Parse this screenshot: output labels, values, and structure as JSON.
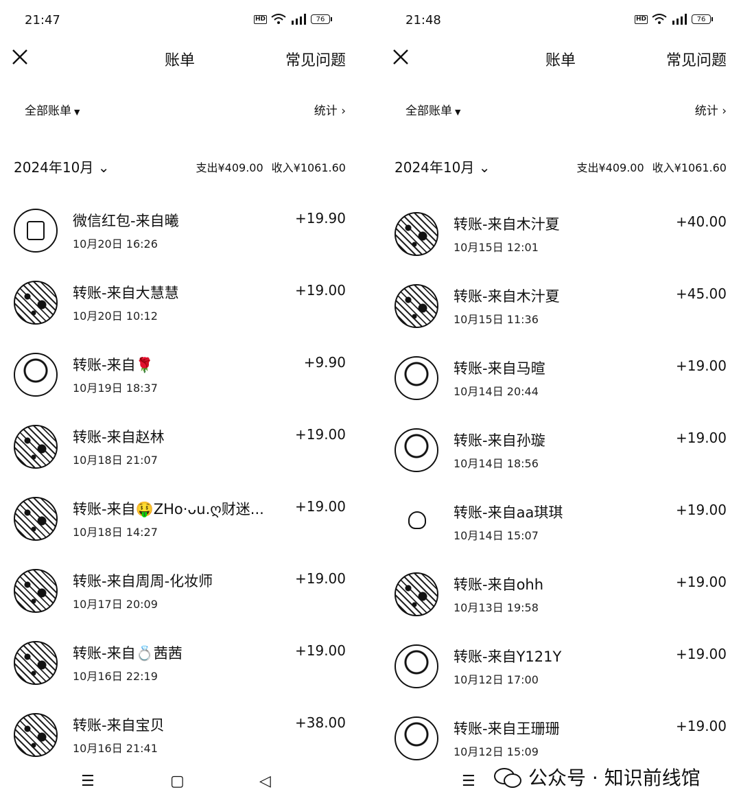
{
  "left": {
    "status_time": "21:47",
    "hd": "HD",
    "battery": "76",
    "title": "账单",
    "faq": "常见问题",
    "filter": "全部账单",
    "stats": "统计",
    "month": "2024年10月",
    "expense": "支出¥409.00",
    "income": "收入¥1061.60",
    "rows": [
      {
        "title": "微信红包-来自曦",
        "time": "10月20日 16:26",
        "amount": "+19.90",
        "avatar": "redpacket"
      },
      {
        "title": "转账-来自大慧慧",
        "time": "10月20日 10:12",
        "amount": "+19.00",
        "avatar": "pattern"
      },
      {
        "title": "转账-来自🌹",
        "time": "10月19日 18:37",
        "amount": "+9.90",
        "avatar": "sketch"
      },
      {
        "title": "转账-来自赵林",
        "time": "10月18日 21:07",
        "amount": "+19.00",
        "avatar": "pattern"
      },
      {
        "title": "转账-来自🤑ZHo·ᴗu.ღ财迷...",
        "time": "10月18日 14:27",
        "amount": "+19.00",
        "avatar": "pattern"
      },
      {
        "title": "转账-来自周周-化妆师",
        "time": "10月17日 20:09",
        "amount": "+19.00",
        "avatar": "pattern"
      },
      {
        "title": "转账-来自💍茜茜",
        "time": "10月16日 22:19",
        "amount": "+19.00",
        "avatar": "pattern"
      },
      {
        "title": "转账-来自宝贝",
        "time": "10月16日 21:41",
        "amount": "+38.00",
        "avatar": "pattern"
      }
    ]
  },
  "right": {
    "status_time": "21:48",
    "hd": "HD",
    "battery": "76",
    "title": "账单",
    "faq": "常见问题",
    "filter": "全部账单",
    "stats": "统计",
    "month": "2024年10月",
    "expense": "支出¥409.00",
    "income": "收入¥1061.60",
    "rows": [
      {
        "title": "转账-来自木汁夏",
        "time": "10月15日 12:01",
        "amount": "+40.00",
        "avatar": "pattern"
      },
      {
        "title": "转账-来自木汁夏",
        "time": "10月15日 11:36",
        "amount": "+45.00",
        "avatar": "pattern"
      },
      {
        "title": "转账-来自马暄",
        "time": "10月14日 20:44",
        "amount": "+19.00",
        "avatar": "sketch"
      },
      {
        "title": "转账-来自孙璇",
        "time": "10月14日 18:56",
        "amount": "+19.00",
        "avatar": "sketch"
      },
      {
        "title": "转账-来自aa琪琪",
        "time": "10月14日 15:07",
        "amount": "+19.00",
        "avatar": "plain"
      },
      {
        "title": "转账-来自ohh",
        "time": "10月13日 19:58",
        "amount": "+19.00",
        "avatar": "pattern"
      },
      {
        "title": "转账-来自Y121Y",
        "time": "10月12日 17:00",
        "amount": "+19.00",
        "avatar": "sketch"
      },
      {
        "title": "转账-来自王珊珊",
        "time": "10月12日 15:09",
        "amount": "+19.00",
        "avatar": "sketch"
      }
    ]
  },
  "nav": {
    "menu": "☰",
    "home": "▢",
    "back": "◁"
  },
  "watermark": "公众号 · 知识前线馆"
}
